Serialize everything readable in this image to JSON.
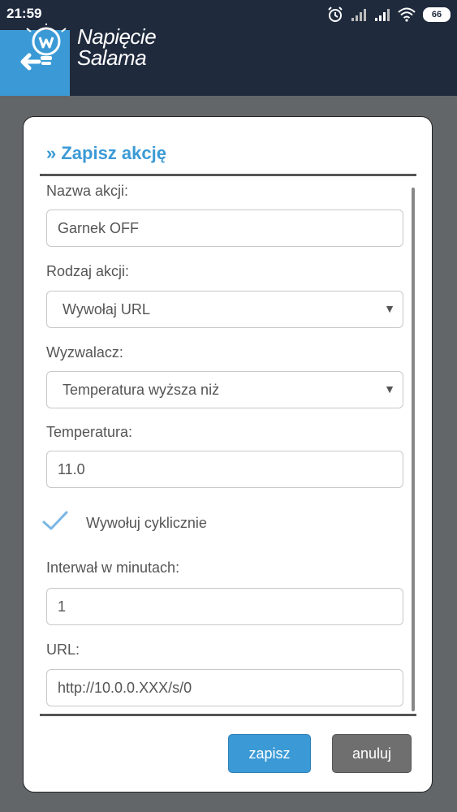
{
  "status_bar": {
    "time": "21:59",
    "battery_level": "66",
    "icons": [
      "alarm-icon",
      "signal-icon",
      "signal-icon",
      "wifi-icon",
      "battery-icon"
    ]
  },
  "header": {
    "logo_line1": "Napięcie",
    "logo_line2": "Salama",
    "back_icon": "arrow-left-icon",
    "accent_color": "#3b9ad6",
    "background_color": "#1f2a3d"
  },
  "dialog": {
    "title": "» Zapisz akcję",
    "fields": {
      "name": {
        "label": "Nazwa akcji:",
        "value": "Garnek OFF"
      },
      "action_type": {
        "label": "Rodzaj akcji:",
        "value": "Wywołaj URL"
      },
      "trigger": {
        "label": "Wyzwalacz:",
        "value": "Temperatura wyższa niż"
      },
      "temperature": {
        "label": "Temperatura:",
        "value": "11.0"
      },
      "cyclic": {
        "label": "Wywołuj cyklicznie",
        "checked": true
      },
      "interval": {
        "label": "Interwał w minutach:",
        "value": "1"
      },
      "url": {
        "label": "URL:",
        "value": "http://10.0.0.XXX/s/0"
      }
    },
    "buttons": {
      "save": "zapisz",
      "cancel": "anuluj"
    }
  }
}
